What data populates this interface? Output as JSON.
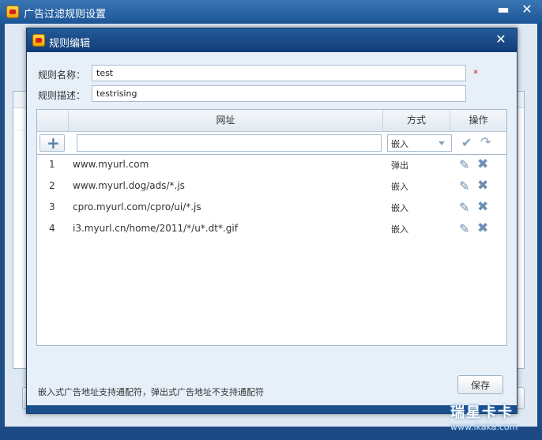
{
  "outer_window": {
    "title": "广告过滤规则设置",
    "minimize_label": "▬",
    "close_label": "✕"
  },
  "dialog": {
    "title": "规则编辑",
    "close_label": "✕",
    "name_label": "规则名称：",
    "name_value": "test",
    "required_mark": "*",
    "desc_label": "规则描述：",
    "desc_value": "testrising"
  },
  "grid": {
    "columns": [
      "网址",
      "方式",
      "操作"
    ],
    "add_label": "+",
    "new_url_value": "",
    "new_mode_selected": "嵌入",
    "rows": [
      {
        "num": "1",
        "url": "www.myurl.com",
        "mode": "弹出"
      },
      {
        "num": "2",
        "url": "www.myurl.dog/ads/*.js",
        "mode": "嵌入"
      },
      {
        "num": "3",
        "url": "cpro.myurl.com/cpro/ui/*.js",
        "mode": "嵌入"
      },
      {
        "num": "4",
        "url": "i3.myurl.cn/home/2011/*/u*.dt*.gif",
        "mode": "嵌入"
      }
    ]
  },
  "footnote": "嵌入式广告地址支持通配符，弹出式广告地址不支持通配符",
  "save_label": "保存",
  "watermark": {
    "brand": "瑞星卡卡",
    "url": "www.ikaka.com"
  },
  "icons": {
    "edit": "pencil-icon",
    "delete": "x-icon",
    "confirm": "check-icon",
    "undo": "redo-arrow-icon",
    "dropdown": "chevron-down-icon"
  }
}
